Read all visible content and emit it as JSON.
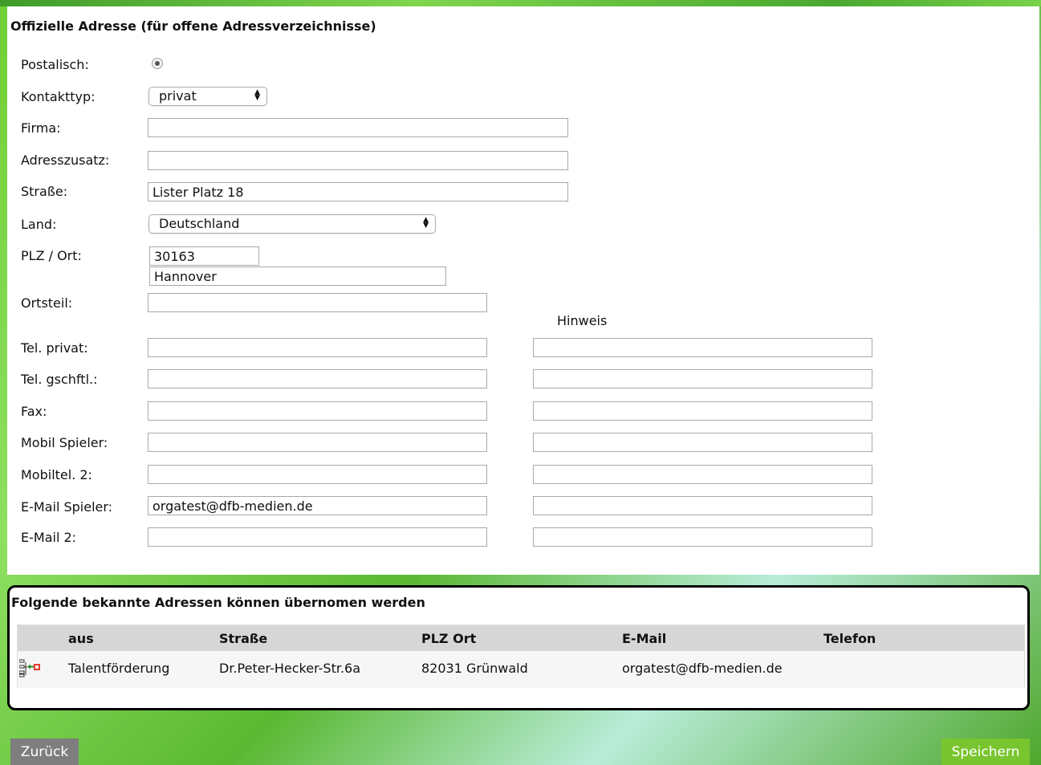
{
  "section_title": "Offizielle Adresse (für offene Adressverzeichnisse)",
  "form": {
    "postal": {
      "label": "Postalisch:",
      "checked": true
    },
    "contact_type": {
      "label": "Kontakttyp:",
      "value": "privat"
    },
    "company": {
      "label": "Firma:",
      "value": ""
    },
    "address_suffix": {
      "label": "Adresszusatz:",
      "value": ""
    },
    "street": {
      "label": "Straße:",
      "value": "Lister Platz 18"
    },
    "country": {
      "label": "Land:",
      "value": "Deutschland"
    },
    "zip_city": {
      "label": "PLZ / Ort:",
      "zip": "30163",
      "city": "Hannover"
    },
    "district": {
      "label": "Ortsteil:",
      "value": ""
    },
    "hint_header": "Hinweis",
    "tel_private": {
      "label": "Tel. privat:",
      "value": "",
      "hint": ""
    },
    "tel_business": {
      "label": "Tel. gschftl.:",
      "value": "",
      "hint": ""
    },
    "fax": {
      "label": "Fax:",
      "value": "",
      "hint": ""
    },
    "mobile_player": {
      "label": "Mobil Spieler:",
      "value": "",
      "hint": ""
    },
    "mobile2": {
      "label": "Mobiltel. 2:",
      "value": "",
      "hint": ""
    },
    "email_player": {
      "label": "E-Mail Spieler:",
      "value": "orgatest@dfb-medien.de",
      "hint": ""
    },
    "email2": {
      "label": "E-Mail 2:",
      "value": "",
      "hint": ""
    }
  },
  "known_addresses": {
    "title": "Folgende bekannte Adressen können übernomen werden",
    "columns": [
      "aus",
      "Straße",
      "PLZ Ort",
      "E-Mail",
      "Telefon"
    ],
    "rows": [
      {
        "icon": "adopt-address-icon",
        "source": "Talentförderung",
        "street": "Dr.Peter-Hecker-Str.6a",
        "zip_city": "82031 Grünwald",
        "email": "orgatest@dfb-medien.de",
        "phone": ""
      }
    ]
  },
  "buttons": {
    "back": "Zurück",
    "save": "Speichern"
  },
  "colors": {
    "accent_green": "#79c52f",
    "back_button_gray": "#7e7e7e",
    "header_row_gray": "#d6d6d6"
  }
}
